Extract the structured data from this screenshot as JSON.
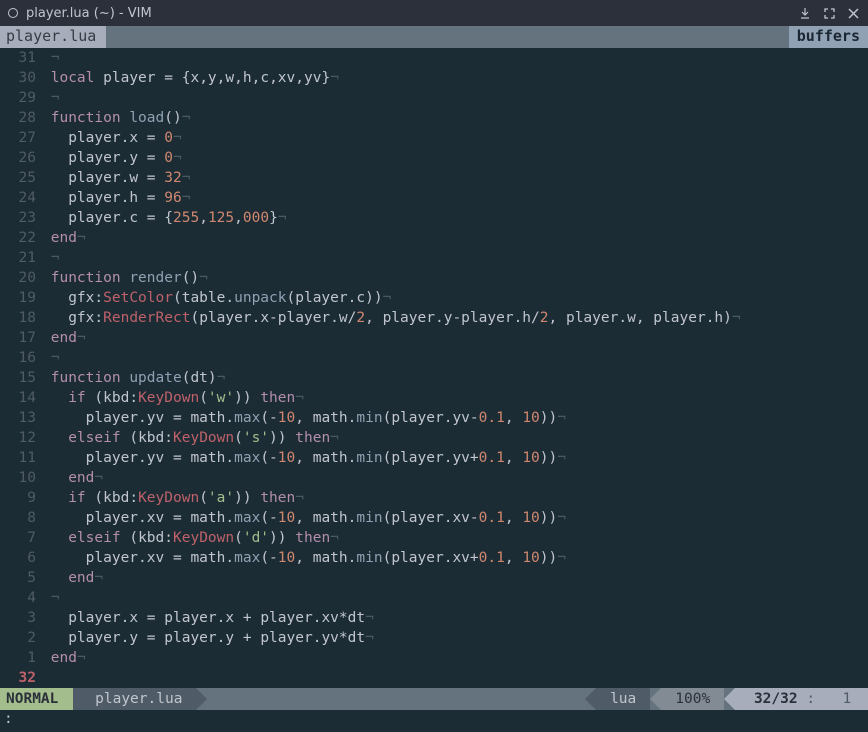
{
  "window": {
    "title": "player.lua (~) - VIM"
  },
  "tabline": {
    "active_tab": "player.lua",
    "buffers_label": "buffers"
  },
  "gutter": {
    "rel": [
      "31",
      "30",
      "29",
      "28",
      "27",
      "26",
      "25",
      "24",
      "23",
      "22",
      "21",
      "20",
      "19",
      "18",
      "17",
      "16",
      "15",
      "14",
      "13",
      "12",
      "11",
      "10",
      "9",
      "8",
      "7",
      "6",
      "5",
      "4",
      "3",
      "2",
      "1"
    ],
    "current": "32"
  },
  "code": {
    "lines_html": [
      "<span class='eol'>¬</span>",
      "<span class='kw'>local</span> <span class='id'>player</span> <span class='op'>=</span> <span class='pun'>{</span><span class='id'>x</span><span class='pun'>,</span><span class='id'>y</span><span class='pun'>,</span><span class='id'>w</span><span class='pun'>,</span><span class='id'>h</span><span class='pun'>,</span><span class='id'>c</span><span class='pun'>,</span><span class='id'>xv</span><span class='pun'>,</span><span class='id'>yv</span><span class='pun'>}</span><span class='eol'>¬</span>",
      "<span class='eol'>¬</span>",
      "<span class='kw'>function</span> <span class='fn'>load</span><span class='pun'>()</span><span class='eol'>¬</span>",
      "  <span class='id'>player</span><span class='pun'>.</span><span class='id'>x</span> <span class='op'>=</span> <span class='num'>0</span><span class='eol'>¬</span>",
      "  <span class='id'>player</span><span class='pun'>.</span><span class='id'>y</span> <span class='op'>=</span> <span class='num'>0</span><span class='eol'>¬</span>",
      "  <span class='id'>player</span><span class='pun'>.</span><span class='id'>w</span> <span class='op'>=</span> <span class='num'>32</span><span class='eol'>¬</span>",
      "  <span class='id'>player</span><span class='pun'>.</span><span class='id'>h</span> <span class='op'>=</span> <span class='num'>96</span><span class='eol'>¬</span>",
      "  <span class='id'>player</span><span class='pun'>.</span><span class='id'>c</span> <span class='op'>=</span> <span class='pun'>{</span><span class='num'>255</span><span class='pun'>,</span><span class='num'>125</span><span class='pun'>,</span><span class='num'>000</span><span class='pun'>}</span><span class='eol'>¬</span>",
      "<span class='kw'>end</span><span class='eol'>¬</span>",
      "<span class='eol'>¬</span>",
      "<span class='kw'>function</span> <span class='fn'>render</span><span class='pun'>()</span><span class='eol'>¬</span>",
      "  <span class='id'>gfx</span><span class='pun'>:</span><span class='member'>SetColor</span><span class='pun'>(</span><span class='id'>table</span><span class='pun'>.</span><span class='fn'>unpack</span><span class='pun'>(</span><span class='id'>player</span><span class='pun'>.</span><span class='id'>c</span><span class='pun'>))</span><span class='eol'>¬</span>",
      "  <span class='id'>gfx</span><span class='pun'>:</span><span class='member'>RenderRect</span><span class='pun'>(</span><span class='id'>player</span><span class='pun'>.</span><span class='id'>x</span><span class='op'>-</span><span class='id'>player</span><span class='pun'>.</span><span class='id'>w</span><span class='op'>/</span><span class='num'>2</span><span class='pun'>,</span> <span class='id'>player</span><span class='pun'>.</span><span class='id'>y</span><span class='op'>-</span><span class='id'>player</span><span class='pun'>.</span><span class='id'>h</span><span class='op'>/</span><span class='num'>2</span><span class='pun'>,</span> <span class='id'>player</span><span class='pun'>.</span><span class='id'>w</span><span class='pun'>,</span> <span class='id'>player</span><span class='pun'>.</span><span class='id'>h</span><span class='pun'>)</span><span class='eol'>¬</span>",
      "<span class='kw'>end</span><span class='eol'>¬</span>",
      "<span class='eol'>¬</span>",
      "<span class='kw'>function</span> <span class='fn'>update</span><span class='pun'>(</span><span class='id'>dt</span><span class='pun'>)</span><span class='eol'>¬</span>",
      "  <span class='kw'>if</span> <span class='pun'>(</span><span class='id'>kbd</span><span class='pun'>:</span><span class='member'>KeyDown</span><span class='pun'>(</span><span class='str'>'w'</span><span class='pun'>))</span> <span class='kw'>then</span><span class='eol'>¬</span>",
      "    <span class='id'>player</span><span class='pun'>.</span><span class='id'>yv</span> <span class='op'>=</span> <span class='id'>math</span><span class='pun'>.</span><span class='fn'>max</span><span class='pun'>(</span><span class='op'>-</span><span class='num'>10</span><span class='pun'>,</span> <span class='id'>math</span><span class='pun'>.</span><span class='fn'>min</span><span class='pun'>(</span><span class='id'>player</span><span class='pun'>.</span><span class='id'>yv</span><span class='op'>-</span><span class='num'>0.1</span><span class='pun'>,</span> <span class='num'>10</span><span class='pun'>))</span><span class='eol'>¬</span>",
      "  <span class='kw'>elseif</span> <span class='pun'>(</span><span class='id'>kbd</span><span class='pun'>:</span><span class='member'>KeyDown</span><span class='pun'>(</span><span class='str'>'s'</span><span class='pun'>))</span> <span class='kw'>then</span><span class='eol'>¬</span>",
      "    <span class='id'>player</span><span class='pun'>.</span><span class='id'>yv</span> <span class='op'>=</span> <span class='id'>math</span><span class='pun'>.</span><span class='fn'>max</span><span class='pun'>(</span><span class='op'>-</span><span class='num'>10</span><span class='pun'>,</span> <span class='id'>math</span><span class='pun'>.</span><span class='fn'>min</span><span class='pun'>(</span><span class='id'>player</span><span class='pun'>.</span><span class='id'>yv</span><span class='op'>+</span><span class='num'>0.1</span><span class='pun'>,</span> <span class='num'>10</span><span class='pun'>))</span><span class='eol'>¬</span>",
      "  <span class='kw'>end</span><span class='eol'>¬</span>",
      "  <span class='kw'>if</span> <span class='pun'>(</span><span class='id'>kbd</span><span class='pun'>:</span><span class='member'>KeyDown</span><span class='pun'>(</span><span class='str'>'a'</span><span class='pun'>))</span> <span class='kw'>then</span><span class='eol'>¬</span>",
      "    <span class='id'>player</span><span class='pun'>.</span><span class='id'>xv</span> <span class='op'>=</span> <span class='id'>math</span><span class='pun'>.</span><span class='fn'>max</span><span class='pun'>(</span><span class='op'>-</span><span class='num'>10</span><span class='pun'>,</span> <span class='id'>math</span><span class='pun'>.</span><span class='fn'>min</span><span class='pun'>(</span><span class='id'>player</span><span class='pun'>.</span><span class='id'>xv</span><span class='op'>-</span><span class='num'>0.1</span><span class='pun'>,</span> <span class='num'>10</span><span class='pun'>))</span><span class='eol'>¬</span>",
      "  <span class='kw'>elseif</span> <span class='pun'>(</span><span class='id'>kbd</span><span class='pun'>:</span><span class='member'>KeyDown</span><span class='pun'>(</span><span class='str'>'d'</span><span class='pun'>))</span> <span class='kw'>then</span><span class='eol'>¬</span>",
      "    <span class='id'>player</span><span class='pun'>.</span><span class='id'>xv</span> <span class='op'>=</span> <span class='id'>math</span><span class='pun'>.</span><span class='fn'>max</span><span class='pun'>(</span><span class='op'>-</span><span class='num'>10</span><span class='pun'>,</span> <span class='id'>math</span><span class='pun'>.</span><span class='fn'>min</span><span class='pun'>(</span><span class='id'>player</span><span class='pun'>.</span><span class='id'>xv</span><span class='op'>+</span><span class='num'>0.1</span><span class='pun'>,</span> <span class='num'>10</span><span class='pun'>))</span><span class='eol'>¬</span>",
      "  <span class='kw'>end</span><span class='eol'>¬</span>",
      "<span class='eol'>¬</span>",
      "  <span class='id'>player</span><span class='pun'>.</span><span class='id'>x</span> <span class='op'>=</span> <span class='id'>player</span><span class='pun'>.</span><span class='id'>x</span> <span class='op'>+</span> <span class='id'>player</span><span class='pun'>.</span><span class='id'>xv</span><span class='op'>*</span><span class='id'>dt</span><span class='eol'>¬</span>",
      "  <span class='id'>player</span><span class='pun'>.</span><span class='id'>y</span> <span class='op'>=</span> <span class='id'>player</span><span class='pun'>.</span><span class='id'>y</span> <span class='op'>+</span> <span class='id'>player</span><span class='pun'>.</span><span class='id'>yv</span><span class='op'>*</span><span class='id'>dt</span><span class='eol'>¬</span>",
      "<span class='kw'>end</span><span class='eol'>¬</span>",
      ""
    ]
  },
  "status": {
    "mode": "NORMAL",
    "file": "player.lua",
    "filetype": "lua",
    "percent": "100%",
    "position": "32/32",
    "sep": ":",
    "col": "1"
  },
  "cmdline": {
    "prompt": ":"
  }
}
